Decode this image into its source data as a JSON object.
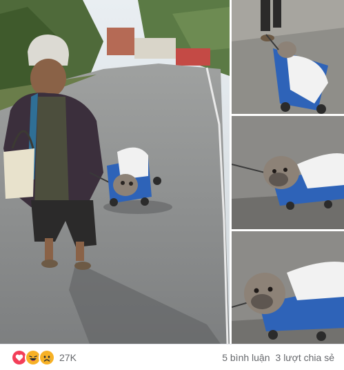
{
  "post": {
    "photos": [
      {
        "label": "main-photo"
      },
      {
        "label": "side-photo-1"
      },
      {
        "label": "side-photo-2"
      },
      {
        "label": "side-photo-3"
      }
    ],
    "reactions": {
      "icons": [
        "love-icon",
        "haha-icon",
        "sad-icon"
      ],
      "count": "27K"
    },
    "comments_label": "5 bình luận",
    "shares_label": "3 lượt chia sẻ"
  },
  "colors": {
    "love": "#f33e58",
    "haha": "#f7b125",
    "sad": "#f7b125",
    "meta_text": "#65676b"
  }
}
